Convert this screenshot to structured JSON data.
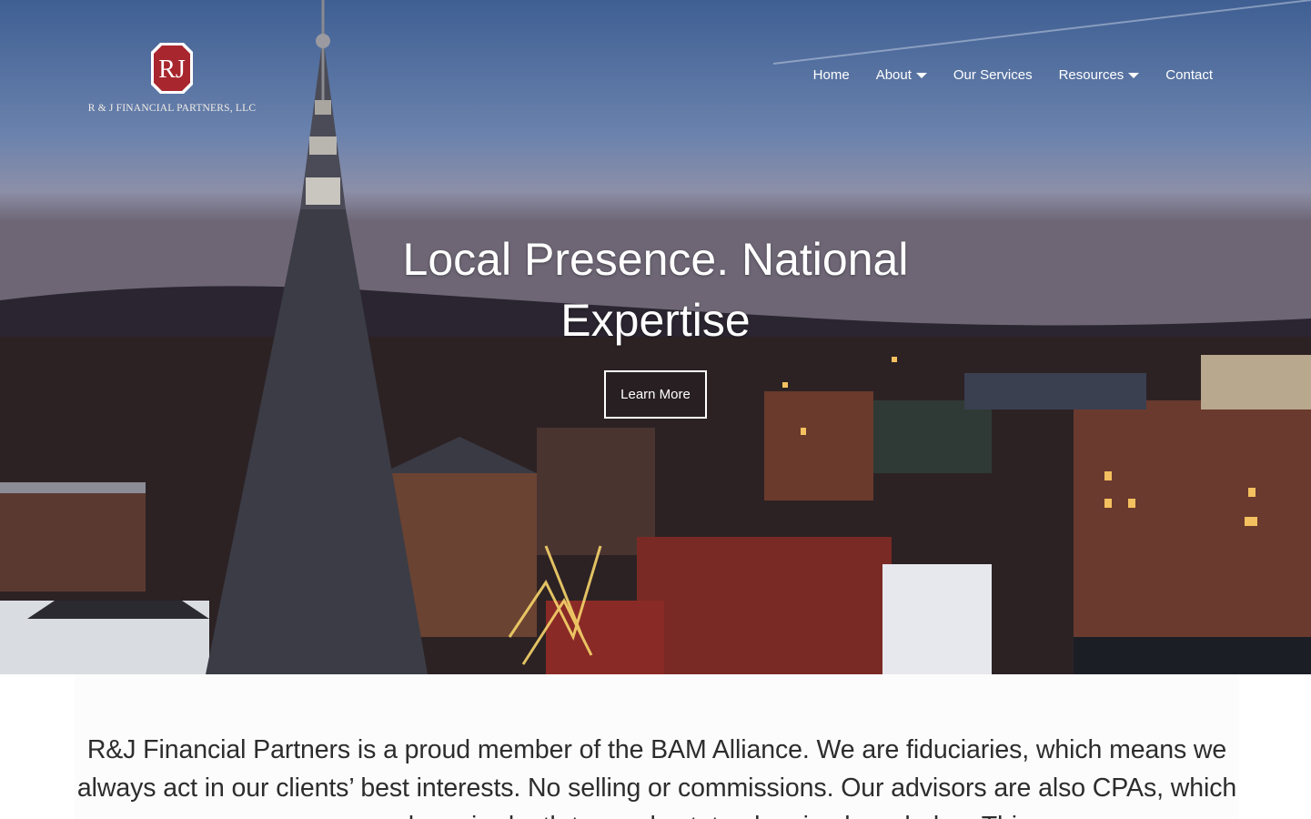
{
  "brand": {
    "monogram": "RJ",
    "name": "R & J FINANCIAL PARTNERS, LLC",
    "accent": "#a8262e"
  },
  "nav": {
    "items": [
      {
        "label": "Home",
        "dropdown": false
      },
      {
        "label": "About",
        "dropdown": true
      },
      {
        "label": "Our Services",
        "dropdown": false
      },
      {
        "label": "Resources",
        "dropdown": true
      },
      {
        "label": "Contact",
        "dropdown": false
      }
    ]
  },
  "hero": {
    "headline": "Local Presence. National Expertise",
    "cta_label": "Learn More"
  },
  "intro": {
    "text": "R&J Financial Partners is a proud member of the BAM Alliance.  We are fiduciaries, which means we always act in our clients’ best interests. No selling or commissions. Our advisors are also CPAs, which means we have in-depth tax and estate planning knowledge. This"
  },
  "colors": {
    "nav_text": "#ffffff",
    "body_text": "#2d2d2d"
  }
}
